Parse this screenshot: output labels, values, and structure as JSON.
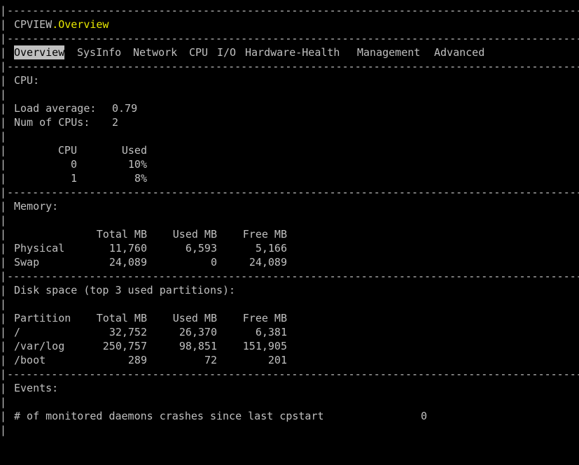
{
  "header": {
    "app_name": "CPVIEW",
    "separator": ".",
    "current_view": "Overview"
  },
  "tabs": [
    {
      "label": "Overview",
      "active": true
    },
    {
      "label": "SysInfo",
      "active": false
    },
    {
      "label": "Network",
      "active": false
    },
    {
      "label": "CPU",
      "active": false
    },
    {
      "label": "I/O",
      "active": false
    },
    {
      "label": "Hardware-Health",
      "active": false
    },
    {
      "label": "Management",
      "active": false
    },
    {
      "label": "Advanced",
      "active": false
    }
  ],
  "cpu": {
    "title": "CPU:",
    "load_label": "Load average:",
    "load_value": "0.79",
    "num_label": "Num of CPUs:",
    "num_value": "2",
    "col_cpu": "CPU",
    "col_used": "Used",
    "rows": [
      {
        "cpu": "0",
        "used": "10%"
      },
      {
        "cpu": "1",
        "used": "8%"
      }
    ]
  },
  "memory": {
    "title": "Memory:",
    "col_total": "Total MB",
    "col_used": "Used MB",
    "col_free": "Free MB",
    "rows": [
      {
        "name": "Physical",
        "total": "11,760",
        "used": "6,593",
        "free": "5,166"
      },
      {
        "name": "Swap",
        "total": "24,089",
        "used": "0",
        "free": "24,089"
      }
    ]
  },
  "disk": {
    "title": "Disk space (top 3 used partitions):",
    "col_partition": "Partition",
    "col_total": "Total MB",
    "col_used": "Used MB",
    "col_free": "Free MB",
    "rows": [
      {
        "name": "/",
        "total": "32,752",
        "used": "26,370",
        "free": "6,381"
      },
      {
        "name": "/var/log",
        "total": "250,757",
        "used": "98,851",
        "free": "151,905"
      },
      {
        "name": "/boot",
        "total": "289",
        "used": "72",
        "free": "201"
      }
    ]
  },
  "events": {
    "title": "Events:",
    "crash_label": "# of monitored daemons crashes since last cpstart",
    "crash_value": "0"
  },
  "colors": {
    "background": "#000000",
    "text": "#c0c0c0",
    "highlight": "#e8e800",
    "tab_active_bg": "#c0c0c0"
  }
}
